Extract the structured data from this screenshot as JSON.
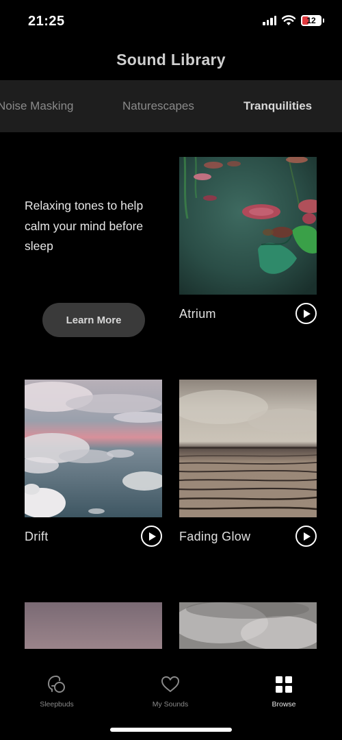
{
  "status": {
    "time": "21:25",
    "battery": "12"
  },
  "header": {
    "title": "Sound Library"
  },
  "tabs": [
    {
      "label": "Noise Masking"
    },
    {
      "label": "Naturescapes"
    },
    {
      "label": "Tranquilities",
      "active": true
    }
  ],
  "intro": {
    "text": "Relaxing tones to help calm your mind before sleep",
    "button": "Learn More"
  },
  "sounds": [
    {
      "name": "Atrium",
      "image": "lily-pond"
    },
    {
      "name": "Drift",
      "image": "clouds-pink-sky"
    },
    {
      "name": "Fading Glow",
      "image": "misty-shoreline"
    },
    {
      "name": "",
      "image": "dusk-gradient"
    },
    {
      "name": "",
      "image": "fog"
    }
  ],
  "tabbar": [
    {
      "label": "Sleepbuds",
      "icon": "sleepbuds-icon"
    },
    {
      "label": "My Sounds",
      "icon": "heart-icon"
    },
    {
      "label": "Browse",
      "icon": "grid-icon",
      "active": true
    }
  ],
  "colors": {
    "background": "#000000",
    "tab_strip": "#1e1e1e",
    "button": "#3a3a3a",
    "battery_low": "#e0383e"
  }
}
